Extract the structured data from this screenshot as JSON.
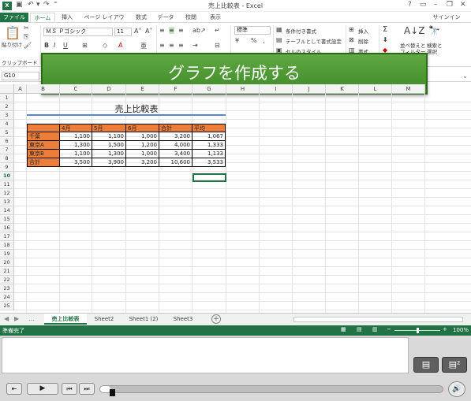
{
  "window": {
    "title": "売上比較表 - Excel",
    "help": "?",
    "sign_in": "サインイン"
  },
  "ribbon_tabs": [
    {
      "label": "ファイル"
    },
    {
      "label": "ホーム"
    },
    {
      "label": "挿入"
    },
    {
      "label": "ページ レイアウト"
    },
    {
      "label": "数式"
    },
    {
      "label": "データ"
    },
    {
      "label": "校閲"
    },
    {
      "label": "表示"
    }
  ],
  "ribbon": {
    "paste_label": "貼り付け",
    "clipboard_group": "クリップボード",
    "font_name": "ＭＳ Ｐゴシック",
    "font_size": "11",
    "number_format": "標準",
    "conditional_format": "条件付き書式",
    "format_as_table": "テーブルとして書式設定",
    "cell_styles": "セルのスタイル",
    "insert": "挿入",
    "delete": "削除",
    "format": "書式",
    "sort_filter": "並べ替えと",
    "sort_filter_2": "フィルター",
    "find_select": "検索と",
    "find_select_2": "選択"
  },
  "banner": {
    "text": "グラフを作成する"
  },
  "formula_bar": {
    "name_box": "G10",
    "content": ""
  },
  "columns": [
    "A",
    "B",
    "C",
    "D",
    "E",
    "F",
    "G",
    "H",
    "I",
    "J",
    "K",
    "L",
    "M"
  ],
  "rows": [
    "1",
    "2",
    "3",
    "4",
    "5",
    "6",
    "7",
    "8",
    "9",
    "10",
    "11",
    "12",
    "13",
    "14",
    "15",
    "16",
    "17",
    "18",
    "19",
    "20",
    "21",
    "22",
    "23",
    "24",
    "25"
  ],
  "sheet": {
    "title": "売上比較表",
    "headers": [
      "",
      "4月",
      "5月",
      "6月",
      "合計",
      "平均"
    ],
    "table": [
      [
        "千葉",
        "1,100",
        "1,100",
        "1,000",
        "3,200",
        "1,067"
      ],
      [
        "東京A",
        "1,300",
        "1,500",
        "1,200",
        "4,000",
        "1,333"
      ],
      [
        "東京B",
        "1,100",
        "1,300",
        "1,000",
        "3,400",
        "1,133"
      ],
      [
        "合計",
        "3,500",
        "3,900",
        "3,200",
        "10,600",
        "3,533"
      ]
    ],
    "header_color": "#EC7E3A",
    "active_cell": "G10"
  },
  "sheet_tabs": [
    "売上比較表",
    "Sheet2",
    "Sheet1 (2)",
    "Sheet3"
  ],
  "status": {
    "ready": "準備完了",
    "zoom": "100%"
  },
  "player": {
    "progress": 0.03
  }
}
